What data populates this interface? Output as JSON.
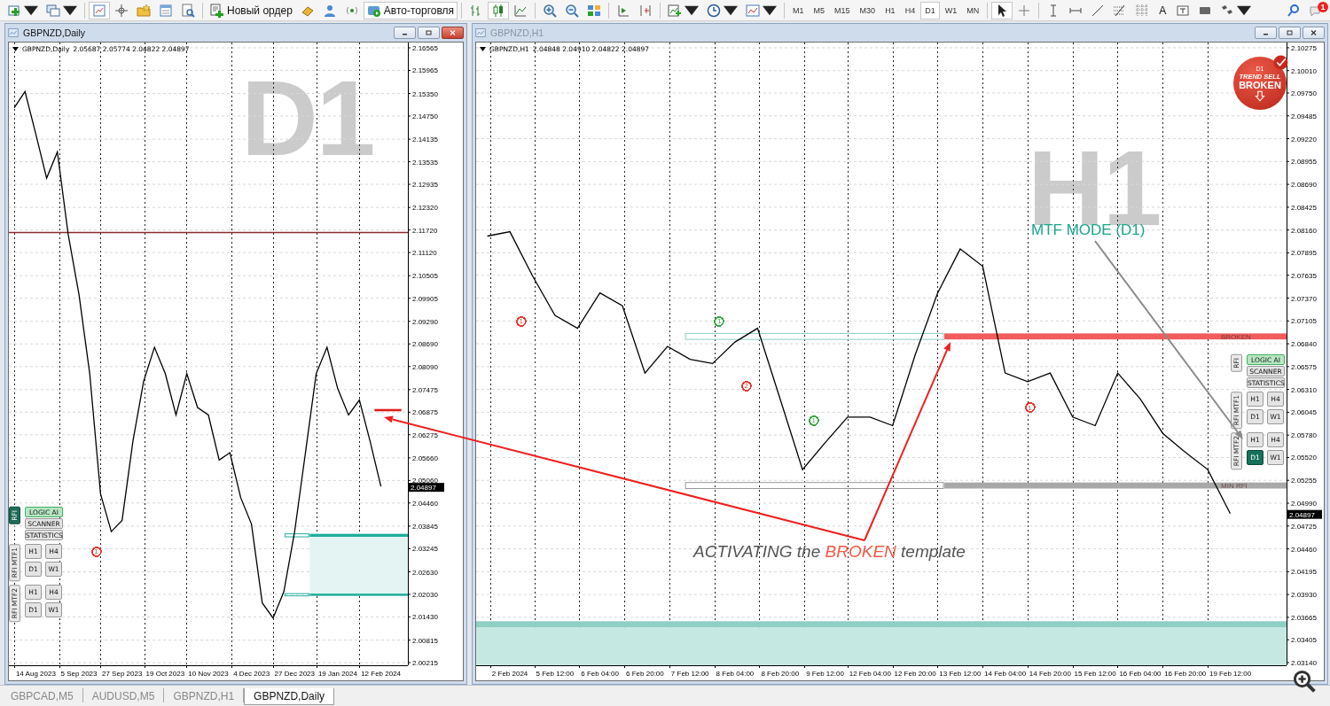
{
  "toolbar": {
    "order_button": "Новый ордер",
    "autotrade_button": "Авто-торговля",
    "timeframes": [
      {
        "label": "M1",
        "selected": false
      },
      {
        "label": "M5",
        "selected": false
      },
      {
        "label": "M15",
        "selected": false
      },
      {
        "label": "M30",
        "selected": false
      },
      {
        "label": "H1",
        "selected": false
      },
      {
        "label": "H4",
        "selected": false
      },
      {
        "label": "D1",
        "selected": true
      },
      {
        "label": "W1",
        "selected": false
      },
      {
        "label": "MN",
        "selected": false
      }
    ],
    "text_tool": "A",
    "notification_count": "1"
  },
  "windows": [
    {
      "title": "GBPNZD,Daily",
      "active": true,
      "chart": {
        "ohlc": "2.05687 2.05774 2.04822 2.04897",
        "big_label": "D1",
        "current_price": "2.04897",
        "signals": [
          {
            "text": "1",
            "color": "#e53935"
          }
        ],
        "chart_data": {
          "type": "line",
          "grid": true,
          "ylim": [
            2.00145,
            2.16706
          ],
          "categories": [
            null,
            null,
            "14 Aug 2023",
            null,
            null,
            null,
            "5 Sep 2023",
            null,
            null,
            null,
            "27 Sep 2023",
            null,
            null,
            null,
            "19 Oct 2023",
            null,
            null,
            null,
            "10 Nov 2023",
            null,
            null,
            null,
            "4 Dec 2023",
            null,
            null,
            null,
            "27 Dec 2023",
            null,
            null,
            null,
            "19 Jan 2024",
            null,
            null,
            null,
            "12 Feb 2024",
            null,
            null
          ],
          "series": [
            {
              "name": "GBPNZD,Daily",
              "color": "#000000",
              "values": [
                2.1497,
                2.154,
                2.1427,
                2.131,
                2.138,
                2.116,
                2.1,
                2.079,
                2.047,
                2.037,
                2.04,
                2.061,
                2.077,
                2.086,
                2.079,
                2.068,
                2.079,
                2.07,
                2.068,
                2.056,
                2.058,
                2.046,
                2.039,
                2.018,
                2.014,
                2.021,
                2.037,
                2.058,
                2.079,
                2.086,
                2.075,
                2.068,
                2.072,
                2.061,
                2.049,
                null,
                null
              ]
            }
          ],
          "yticks": [
            {
              "value": 2.16565,
              "label": "2.16565"
            },
            {
              "value": 2.15965,
              "label": "2.15965"
            },
            {
              "value": 2.1535,
              "label": "2.15350"
            },
            {
              "value": 2.1475,
              "label": "2.14750"
            },
            {
              "value": 2.14135,
              "label": "2.14135"
            },
            {
              "value": 2.13535,
              "label": "2.13535"
            },
            {
              "value": 2.12935,
              "label": "2.12935"
            },
            {
              "value": 2.1232,
              "label": "2.12320"
            },
            {
              "value": 2.1172,
              "label": "2.11720"
            },
            {
              "value": 2.1112,
              "label": "2.11120"
            },
            {
              "value": 2.10505,
              "label": "2.10505"
            },
            {
              "value": 2.09905,
              "label": "2.09905"
            },
            {
              "value": 2.0929,
              "label": "2.09290"
            },
            {
              "value": 2.0869,
              "label": "2.08690"
            },
            {
              "value": 2.0809,
              "label": "2.08090"
            },
            {
              "value": 2.07475,
              "label": "2.07475"
            },
            {
              "value": 2.06875,
              "label": "2.06875"
            },
            {
              "value": 2.06275,
              "label": "2.06275"
            },
            {
              "value": 2.0566,
              "label": "2.05660"
            },
            {
              "value": 2.0506,
              "label": "2.05060"
            },
            {
              "value": 2.0446,
              "label": "2.04460"
            },
            {
              "value": 2.03845,
              "label": "2.03845"
            },
            {
              "value": 2.03245,
              "label": "2.03245"
            },
            {
              "value": 2.0263,
              "label": "2.02630"
            },
            {
              "value": 2.0203,
              "label": "2.02030"
            },
            {
              "value": 2.0143,
              "label": "2.01430"
            },
            {
              "value": 2.00815,
              "label": "2.00815"
            },
            {
              "value": 2.00215,
              "label": "2.00215"
            }
          ],
          "ref_lines": [
            {
              "axis": "y",
              "value": 2.1166,
              "color": "#8b2a2a"
            }
          ]
        },
        "panel": {
          "groups": [
            {
              "label": "RFI",
              "selected": true,
              "kind": "list",
              "buttons": [
                {
                  "label": "LOGIC AI",
                  "selected": true
                },
                {
                  "label": "SCANNER",
                  "selected": false
                },
                {
                  "label": "STATISTICS",
                  "selected": false
                }
              ]
            },
            {
              "label": "RFI MTF1",
              "selected": false,
              "kind": "grid",
              "buttons": [
                {
                  "label": "H1",
                  "selected": false
                },
                {
                  "label": "H4",
                  "selected": false
                },
                {
                  "label": "D1",
                  "selected": false
                },
                {
                  "label": "W1",
                  "selected": false
                }
              ]
            },
            {
              "label": "RFI MTF2",
              "selected": false,
              "kind": "grid",
              "buttons": [
                {
                  "label": "H1",
                  "selected": false
                },
                {
                  "label": "H4",
                  "selected": false
                },
                {
                  "label": "D1",
                  "selected": false
                },
                {
                  "label": "W1",
                  "selected": false
                }
              ]
            }
          ]
        }
      }
    },
    {
      "title": "GBPNZD,H1",
      "active": false,
      "chart": {
        "ohlc": "2.04848 2.04910 2.04822 2.04897",
        "big_label": "H1",
        "current_price": "2.04897",
        "mode_label": "MTF MODE (D1)",
        "badge": {
          "timeframe": "D1",
          "title": "TREND SELL",
          "status": "BROKEN"
        },
        "zone_labels": [
          "BROKEN",
          "MIN RFI"
        ],
        "signals": [
          {
            "text": "1",
            "color": "#e53935"
          },
          {
            "text": "1",
            "color": "#3aa845"
          },
          {
            "text": "2",
            "color": "#e53935"
          },
          {
            "text": "1",
            "color": "#3aa845"
          },
          {
            "text": "1",
            "color": "#e53935"
          }
        ],
        "chart_data": {
          "type": "line",
          "grid": true,
          "ylim": [
            2.03109,
            2.10336
          ],
          "categories": [
            null,
            "2 Feb 2024",
            null,
            "5 Feb 12:00",
            null,
            "6 Feb 04:00",
            null,
            "6 Feb 20:00",
            null,
            "7 Feb 12:00",
            null,
            "8 Feb 04:00",
            null,
            "8 Feb 20:00",
            null,
            "9 Feb 12:00",
            null,
            "12 Feb 04:00",
            null,
            "12 Feb 20:00",
            null,
            "13 Feb 12:00",
            null,
            "14 Feb 04:00",
            null,
            "14 Feb 20:00",
            null,
            "15 Feb 12:00",
            null,
            "16 Feb 04:00",
            null,
            "16 Feb 20:00",
            null,
            "19 Feb 12:00",
            null,
            null
          ],
          "series": [
            {
              "name": "GBPNZD,H1",
              "color": "#000000",
              "values": [
                2.0809,
                2.0814,
                2.0763,
                2.0717,
                2.0702,
                2.0743,
                2.0728,
                2.065,
                2.0681,
                2.0666,
                2.0661,
                2.0686,
                2.0702,
                2.062,
                2.0538,
                2.0569,
                2.0599,
                2.0599,
                2.0589,
                2.0671,
                2.0743,
                2.0794,
                2.0774,
                2.065,
                2.064,
                2.065,
                2.0599,
                2.0589,
                2.065,
                2.062,
                2.058,
                2.0558,
                2.0538,
                2.0487,
                null,
                null
              ]
            }
          ],
          "yticks": [
            {
              "value": 2.10275,
              "label": "2.10275"
            },
            {
              "value": 2.1001,
              "label": "2.10010"
            },
            {
              "value": 2.0975,
              "label": "2.09750"
            },
            {
              "value": 2.09485,
              "label": "2.09485"
            },
            {
              "value": 2.0922,
              "label": "2.09220"
            },
            {
              "value": 2.08955,
              "label": "2.08955"
            },
            {
              "value": 2.0869,
              "label": "2.08690"
            },
            {
              "value": 2.08425,
              "label": "2.08425"
            },
            {
              "value": 2.0816,
              "label": "2.08160"
            },
            {
              "value": 2.07895,
              "label": "2.07895"
            },
            {
              "value": 2.07635,
              "label": "2.07635"
            },
            {
              "value": 2.0737,
              "label": "2.07370"
            },
            {
              "value": 2.07105,
              "label": "2.07105"
            },
            {
              "value": 2.0684,
              "label": "2.06840"
            },
            {
              "value": 2.06575,
              "label": "2.06575"
            },
            {
              "value": 2.0631,
              "label": "2.06310"
            },
            {
              "value": 2.06045,
              "label": "2.06045"
            },
            {
              "value": 2.0578,
              "label": "2.05780"
            },
            {
              "value": 2.0552,
              "label": "2.05520"
            },
            {
              "value": 2.05255,
              "label": "2.05255"
            },
            {
              "value": 2.0499,
              "label": "2.04990"
            },
            {
              "value": 2.04725,
              "label": "2.04725"
            },
            {
              "value": 2.0446,
              "label": "2.04460"
            },
            {
              "value": 2.04195,
              "label": "2.04195"
            },
            {
              "value": 2.0393,
              "label": "2.03930"
            },
            {
              "value": 2.03665,
              "label": "2.03665"
            },
            {
              "value": 2.03405,
              "label": "2.03405"
            },
            {
              "value": 2.0314,
              "label": "2.03140"
            }
          ]
        },
        "panel": {
          "groups": [
            {
              "label": "RFI",
              "selected": false,
              "kind": "list",
              "buttons": [
                {
                  "label": "LOGIC AI",
                  "selected": true
                },
                {
                  "label": "SCANNER",
                  "selected": false
                },
                {
                  "label": "STATISTICS",
                  "selected": false
                }
              ]
            },
            {
              "label": "RFI MTF1",
              "selected": false,
              "kind": "grid",
              "buttons": [
                {
                  "label": "H1",
                  "selected": false
                },
                {
                  "label": "H4",
                  "selected": false
                },
                {
                  "label": "D1",
                  "selected": false
                },
                {
                  "label": "W1",
                  "selected": false
                }
              ]
            },
            {
              "label": "RFI MTF2",
              "selected": false,
              "kind": "grid",
              "buttons": [
                {
                  "label": "H1",
                  "selected": false
                },
                {
                  "label": "H4",
                  "selected": false
                },
                {
                  "label": "D1",
                  "selected": true
                },
                {
                  "label": "W1",
                  "selected": false
                }
              ]
            }
          ]
        }
      }
    }
  ],
  "callout": {
    "before": "ACTIVATING the ",
    "highlight": "BROKEN",
    "after": " template"
  },
  "tabs": [
    {
      "label": "GBPCAD,M5",
      "selected": false
    },
    {
      "label": "AUDUSD,M5",
      "selected": false
    },
    {
      "label": "GBPNZD,H1",
      "selected": false
    },
    {
      "label": "GBPNZD,Daily",
      "selected": true
    }
  ]
}
